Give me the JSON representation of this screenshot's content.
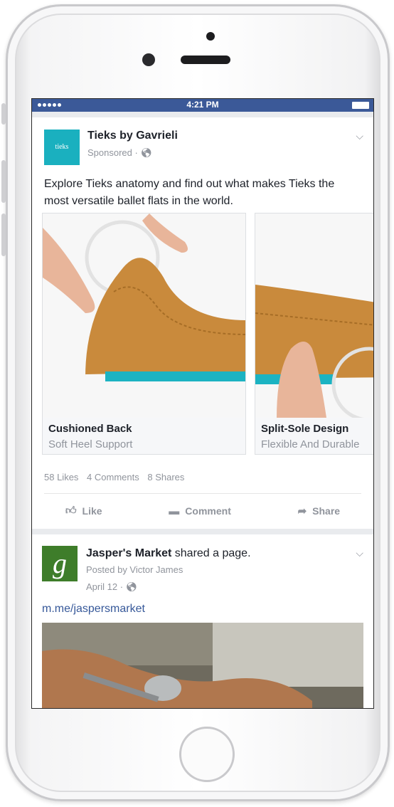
{
  "status_bar": {
    "time": "4:21 PM"
  },
  "post1": {
    "author": "Tieks by Gavrieli",
    "logo_text": "tieks",
    "meta": "Sponsored · ",
    "body": "Explore Tieks anatomy and find out what makes Tieks the most versatile ballet flats in the world.",
    "cards": [
      {
        "title": "Cushioned Back",
        "subtitle": "Soft Heel Support"
      },
      {
        "title": "Split-Sole Design",
        "subtitle": "Flexible And Durable"
      }
    ],
    "counts": {
      "likes": "58 Likes",
      "comments": "4 Comments",
      "shares": "8 Shares"
    },
    "actions": {
      "like": "Like",
      "comment": "Comment",
      "share": "Share"
    }
  },
  "post2": {
    "author": "Jasper's Market",
    "shared_suffix": " shared a page.",
    "logo_text": "g",
    "posted_by": "Posted by Victor James",
    "date": "April 12 · ",
    "link": "m.me/jaspersmarket"
  },
  "colors": {
    "facebook_blue": "#3b5998",
    "tieks_teal": "#1ab0bf",
    "shoe_tan": "#c98a3c",
    "jasper_green": "#3e7d2a"
  }
}
